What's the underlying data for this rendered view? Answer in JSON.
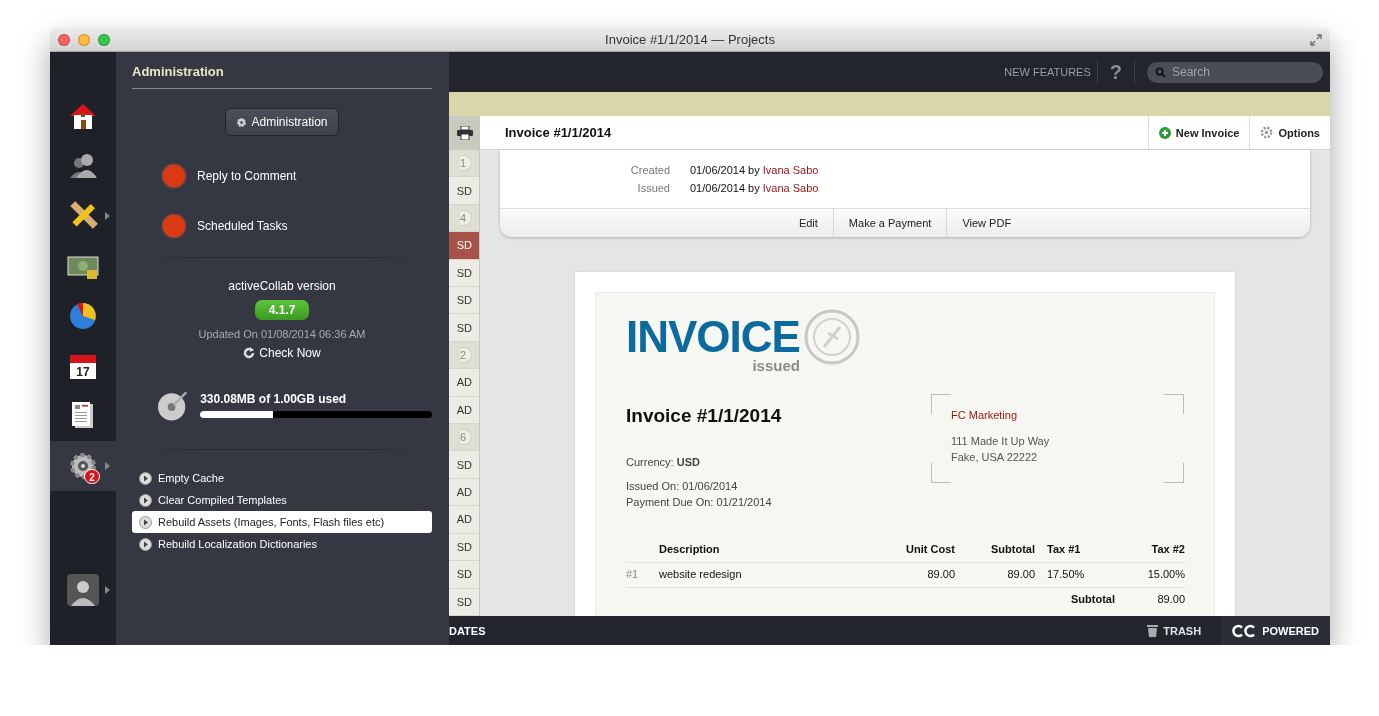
{
  "window": {
    "title": "Invoice #1/1/2014 — Projects"
  },
  "nav_rail": {
    "items": [
      {
        "kind": "home",
        "selected": false,
        "submenu": false
      },
      {
        "kind": "people",
        "selected": false,
        "submenu": false
      },
      {
        "kind": "tools",
        "selected": false,
        "submenu": true
      },
      {
        "kind": "money",
        "selected": false,
        "submenu": false
      },
      {
        "kind": "chart",
        "selected": false,
        "submenu": false
      },
      {
        "kind": "calendar",
        "selected": false,
        "submenu": false,
        "day": "17"
      },
      {
        "kind": "documents",
        "selected": false,
        "submenu": false
      },
      {
        "kind": "settings",
        "selected": true,
        "submenu": true,
        "badge": "2"
      }
    ],
    "profile": {
      "submenu": true
    }
  },
  "admin_panel": {
    "title": "Administration",
    "button": "Administration",
    "alerts": [
      {
        "label": "Reply to Comment",
        "color": "#d93a12"
      },
      {
        "label": "Scheduled Tasks",
        "color": "#d93a12"
      }
    ],
    "version": {
      "label": "activeCollab version",
      "number": "4.1.7",
      "updated": "Updated On 01/08/2014 06:36 AM",
      "check": "Check Now"
    },
    "storage": {
      "usage": "330.08MB of 1.00GB used",
      "level": 0.315
    },
    "tools": [
      {
        "label": "Empty Cache",
        "selected": false
      },
      {
        "label": "Clear Compiled Templates",
        "selected": false
      },
      {
        "label": "Rebuild Assets (Images, Fonts, Flash files etc)",
        "selected": true
      },
      {
        "label": "Rebuild Localization Dictionaries",
        "selected": false
      }
    ]
  },
  "top_bar": {
    "new_features": "NEW FEATURES",
    "help": "?",
    "search": {
      "placeholder": "Search"
    }
  },
  "list_column": {
    "items": [
      {
        "kind": "group",
        "text": "1",
        "selected": false
      },
      {
        "kind": "row",
        "text": "SD",
        "selected": false
      },
      {
        "kind": "group",
        "text": "4",
        "selected": false
      },
      {
        "kind": "row",
        "text": "SD",
        "selected": true
      },
      {
        "kind": "row",
        "text": "SD",
        "selected": false
      },
      {
        "kind": "row",
        "text": "SD",
        "selected": false
      },
      {
        "kind": "row",
        "text": "SD",
        "selected": false
      },
      {
        "kind": "group",
        "text": "2",
        "selected": false
      },
      {
        "kind": "row",
        "text": "AD",
        "selected": false
      },
      {
        "kind": "row",
        "text": "AD",
        "selected": false
      },
      {
        "kind": "group",
        "text": "6",
        "selected": false
      },
      {
        "kind": "row",
        "text": "SD",
        "selected": false
      },
      {
        "kind": "row",
        "text": "AD",
        "selected": false
      },
      {
        "kind": "row",
        "text": "AD",
        "selected": false
      },
      {
        "kind": "row",
        "text": "SD",
        "selected": false
      },
      {
        "kind": "row",
        "text": "SD",
        "selected": false
      },
      {
        "kind": "row",
        "text": "SD",
        "selected": false
      }
    ]
  },
  "invoice_header": {
    "title": "Invoice #1/1/2014",
    "actions": [
      {
        "kind": "new",
        "label": "New Invoice"
      },
      {
        "kind": "options",
        "label": "Options"
      }
    ]
  },
  "details": {
    "fields": [
      {
        "label": "Created",
        "value": "01/06/2014 by",
        "person": "Ivana Sabo"
      },
      {
        "label": "Issued",
        "value": "01/06/2014 by",
        "person": "Ivana Sabo"
      }
    ],
    "actions": [
      "Edit",
      "Make a Payment",
      "View PDF"
    ]
  },
  "document": {
    "logo": "INVOICE",
    "status": "issued",
    "title": "Invoice #1/1/2014",
    "currency": "Currency: **USD**",
    "dates": [
      "Issued On: 01/06/2014",
      "Payment Due On: 01/21/2014"
    ],
    "client": {
      "name": "FC Marketing",
      "address": [
        "111 Made It Up Way",
        "Fake, USA 22222"
      ]
    },
    "table": {
      "columns": [
        "Description",
        "Unit Cost",
        "Subtotal",
        "Tax #1",
        "Tax #2"
      ],
      "rows": [
        {
          "number": "#1",
          "cells": [
            "website redesign",
            "89.00",
            "89.00",
            "17.50%",
            "15.00%"
          ]
        }
      ],
      "subtotal": {
        "label": "Subtotal",
        "value": "89.00"
      }
    }
  },
  "bottom_bar": {
    "left": "DATES",
    "trash": "TRASH",
    "powered": "POWERED"
  }
}
